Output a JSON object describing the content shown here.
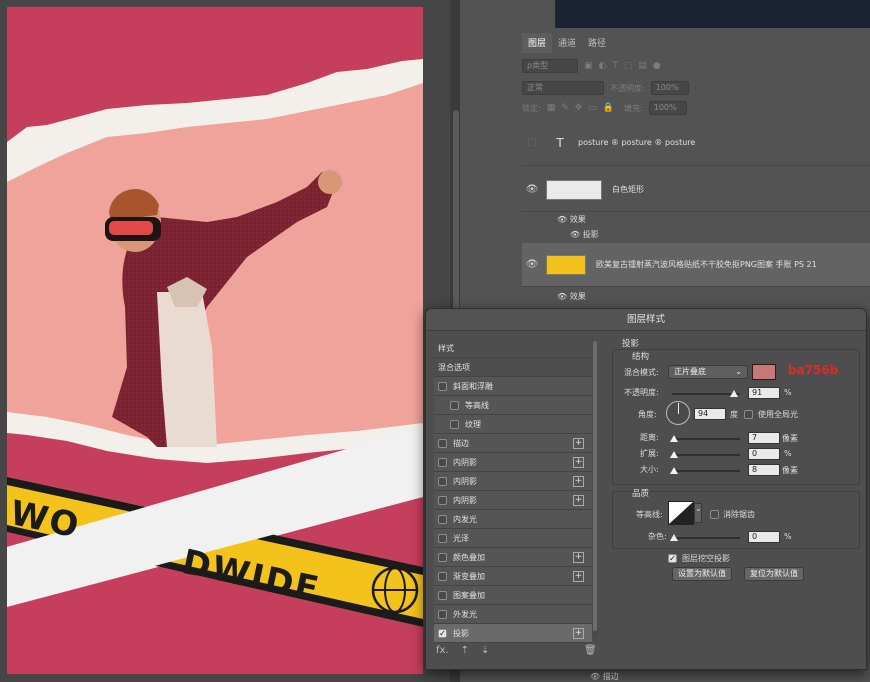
{
  "layers_panel": {
    "tabs": [
      "图层",
      "通道",
      "路径"
    ],
    "filter_label": "ρ类型",
    "blend_mode": "正常",
    "opacity_label": "不透明度:",
    "opacity_value": "100%",
    "lock_label": "锁定:",
    "fill_label": "填充:",
    "fill_value": "100%",
    "layers": [
      {
        "name": "posture ® posture ® posture"
      },
      {
        "name": "白色矩形",
        "effects_label": "效果",
        "effect": "投影"
      },
      {
        "name": "欧美复古镭射蒸汽波风格贴纸不干胶免抠PNG图案 手账 PS 21",
        "effects_label": "效果",
        "effect": "投影"
      }
    ],
    "bottom_effect": "描边"
  },
  "poster": {
    "text_white_strip": "WO",
    "text_yellow_strip": "DWIDE"
  },
  "dialog": {
    "title": "图层样式",
    "styles": [
      {
        "label": "样式",
        "header": true
      },
      {
        "label": "混合选项",
        "header": true
      },
      {
        "label": "斜面和浮雕",
        "checked": false
      },
      {
        "label": "等高线",
        "checked": false,
        "indent": true
      },
      {
        "label": "纹理",
        "checked": false,
        "indent": true
      },
      {
        "label": "描边",
        "checked": false,
        "plus": true
      },
      {
        "label": "内阴影",
        "checked": false,
        "plus": true
      },
      {
        "label": "内阴影",
        "checked": false,
        "plus": true
      },
      {
        "label": "内阴影",
        "checked": false,
        "plus": true
      },
      {
        "label": "内发光",
        "checked": false
      },
      {
        "label": "光泽",
        "checked": false
      },
      {
        "label": "颜色叠加",
        "checked": false,
        "plus": true
      },
      {
        "label": "渐变叠加",
        "checked": false,
        "plus": true
      },
      {
        "label": "图案叠加",
        "checked": false
      },
      {
        "label": "外发光",
        "checked": false
      },
      {
        "label": "投影",
        "checked": true,
        "plus": true,
        "active": true
      }
    ],
    "footer_fx": "fx.",
    "section_title": "投影",
    "structure_title": "结构",
    "blend_mode_label": "混合模式:",
    "blend_mode_value": "正片叠底",
    "shadow_color": "#c97875",
    "color_hex_annotation": "ba756b",
    "opacity_label": "不透明度:",
    "opacity_value": "91",
    "opacity_fraction": 0.91,
    "percent": "%",
    "angle_label": "角度:",
    "angle_value": "94",
    "angle_unit": "度",
    "global_light_label": "使用全局光",
    "distance_label": "距离:",
    "distance_value": "7",
    "spread_label": "扩展:",
    "spread_value": "0",
    "size_label": "大小:",
    "size_value": "8",
    "px_unit": "像素",
    "quality_title": "品质",
    "contour_label": "等高线:",
    "antialias_label": "消除锯齿",
    "noise_label": "杂色:",
    "noise_value": "0",
    "knockout_label": "图层挖空投影",
    "set_default": "设置为默认值",
    "reset_default": "复位为默认值"
  },
  "colors": {
    "poster_red": "#c53e5c",
    "poster_pink": "#f0a39b",
    "tape_yellow": "#f3c21b",
    "annotation_red": "#e02a2a"
  }
}
